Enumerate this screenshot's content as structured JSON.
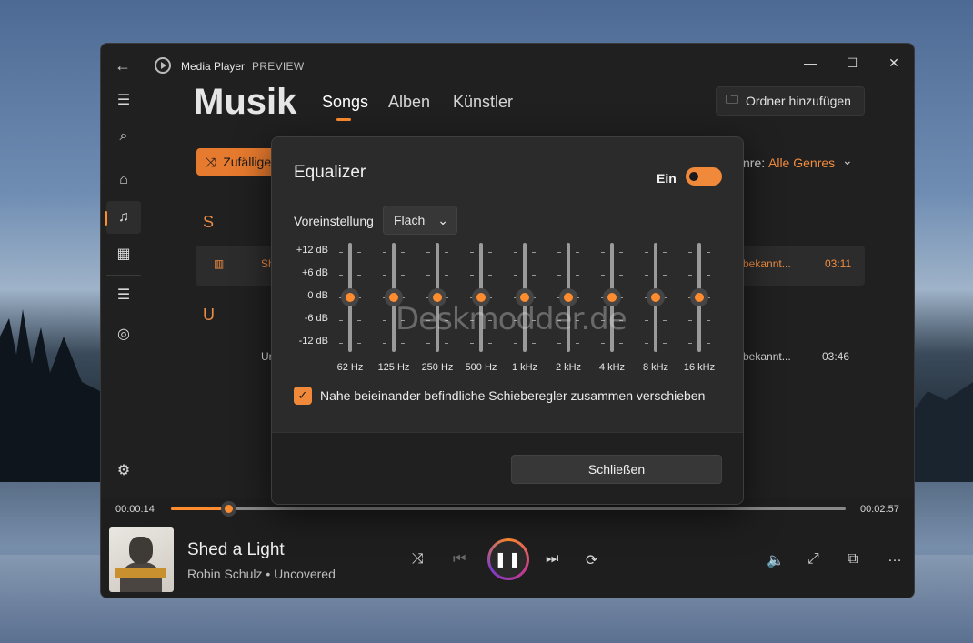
{
  "app": {
    "title": "Media Player",
    "badge": "PREVIEW"
  },
  "page": {
    "heading": "Musik",
    "tabs": [
      "Songs",
      "Alben",
      "Künstler"
    ],
    "active_tab": "Songs"
  },
  "toolbar": {
    "add_folder_label": "Ordner hinzufügen",
    "shuffle_label": "Zufällige",
    "genre_label": "nre:",
    "genre_value": "Alle Genres"
  },
  "song_list": {
    "groups": [
      {
        "letter": "S",
        "row": {
          "title": "Sh",
          "artist": "bekannt...",
          "duration": "03:11"
        }
      },
      {
        "letter": "U",
        "row": {
          "title": "Ur",
          "artist": "bekannt...",
          "duration": "03:46"
        }
      }
    ]
  },
  "player": {
    "elapsed": "00:00:14",
    "total": "00:02:57",
    "progress": 0.085,
    "track_title": "Shed a Light",
    "track_artist": "Robin Schulz • Uncovered",
    "album_tag": "ROBIN SCHULZ"
  },
  "equalizer": {
    "title": "Equalizer",
    "toggle_label": "Ein",
    "enabled": true,
    "preset_label": "Voreinstellung",
    "preset_value": "Flach",
    "db_labels": [
      "+12 dB",
      "+6 dB",
      "0 dB",
      "-6 dB",
      "-12 dB"
    ],
    "bands": [
      {
        "freq": "62 Hz",
        "gain_db": 0
      },
      {
        "freq": "125 Hz",
        "gain_db": 0
      },
      {
        "freq": "250 Hz",
        "gain_db": 0
      },
      {
        "freq": "500 Hz",
        "gain_db": 0
      },
      {
        "freq": "1 kHz",
        "gain_db": 0
      },
      {
        "freq": "2 kHz",
        "gain_db": 0
      },
      {
        "freq": "4 kHz",
        "gain_db": 0
      },
      {
        "freq": "8 kHz",
        "gain_db": 0
      },
      {
        "freq": "16 kHz",
        "gain_db": 0
      }
    ],
    "checkbox_label": "Nahe beieinander befindliche Schieberegler zusammen verschieben",
    "checkbox_checked": true,
    "close_label": "Schließen"
  },
  "watermark": "Deskmodder.de",
  "colors": {
    "accent": "#ff8c2e",
    "window_bg": "#202020",
    "dialog_bg": "#2b2b2b"
  },
  "icons": {
    "back": "←",
    "hamburger": "☰",
    "search": "⌕",
    "home": "⌂",
    "music": "♫",
    "video": "▦",
    "playlist": "☰",
    "disc": "◎",
    "settings": "⚙",
    "minimize": "—",
    "maximize": "☐",
    "close": "✕",
    "shuffle": "⤨",
    "prev": "⏮",
    "next": "⏭",
    "repeat": "⟳",
    "volume": "🔈",
    "expand": "⤢",
    "miniplayer": "⧉",
    "more": "…",
    "folder_add": "🗀",
    "chevron_down": "⌄",
    "check": "✓",
    "pause": "❚❚",
    "equalizer_bars": "▥"
  }
}
